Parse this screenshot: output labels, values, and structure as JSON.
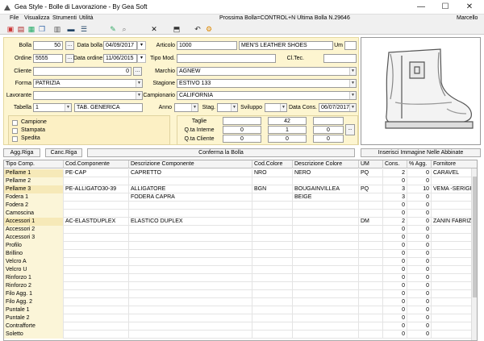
{
  "window": {
    "title": "Gea Style - Bolle di Lavorazione - By Gea Soft",
    "controls": [
      "—",
      "☐",
      "✕"
    ]
  },
  "menu": {
    "items": [
      "File",
      "Visualizza",
      "Strumenti",
      "Utilità"
    ],
    "next_info": "Prossima Bolla=CONTROL+N Ultima Bolla N.29646",
    "user": "Marcello"
  },
  "toolbar": {
    "icons": [
      "print-icon",
      "print-preview-icon",
      "export-icon",
      "copy-icon",
      "grid-icon",
      "save-icon",
      "list-icon",
      "edit-icon",
      "delete-icon",
      "archive-icon",
      "undo-icon",
      "settings-icon"
    ]
  },
  "form": {
    "bolla_label": "Bolla",
    "bolla": "50",
    "data_bolla_label": "Data bolla",
    "data_bolla": "04/09/2017",
    "articolo_label": "Articolo",
    "articolo_code": "1000",
    "articolo_desc": "MEN'S LEATHER SHOES",
    "um_label": "Um",
    "um": "",
    "ordine_label": "Ordine",
    "ordine": "5555",
    "data_ordine_label": "Data ordine",
    "data_ordine": "11/06/2015",
    "tipo_mod_label": "Tipo Mod.",
    "tipo_mod": "",
    "cl_tec_label": "Cl.Tec.",
    "cl_tec": "",
    "cliente_label": "Cliente",
    "cliente": "0",
    "marchio_label": "Marchio",
    "marchio": "AGNEW",
    "forma_label": "Forma",
    "forma": "PATRIZIA",
    "stagione_label": "Stagione",
    "stagione": "ESTIVO 133",
    "lavorante_label": "Lavorante",
    "lavorante": "",
    "campionario_label": "Campionario",
    "campionario": "CALIFORNIA",
    "tabella_label": "Tabella",
    "tabella": "1",
    "tabella_desc": "TAB. GENERICA",
    "anno_label": "Anno",
    "anno": "",
    "stag_label": "Stag.",
    "stag": "",
    "sviluppo_label": "Sviluppo",
    "sviluppo": "",
    "data_cons_label": "Data Cons.",
    "data_cons": "06/07/2017",
    "checks": [
      "Campione",
      "Stampata",
      "Spedita"
    ],
    "taglie_label": "Taglie",
    "qta_interne_label": "Q.ta Interne",
    "qta_cliente_label": "Q.ta Cliente",
    "taglie": [
      "",
      "42",
      ""
    ],
    "qta_interne": [
      "0",
      "1",
      "0"
    ],
    "qta_cliente": [
      "0",
      "0",
      "0"
    ],
    "more_label": "..."
  },
  "actions": {
    "add_row": "Agg.Riga",
    "del_row": "Canc.Riga",
    "confirm": "Conferma la Bolla",
    "insert_image": "Inserisci Immagine Nelle Abbinate"
  },
  "grid": {
    "headers": [
      "Tipo Comp.",
      "Cod.Componente",
      "Descrizione Componente",
      "Cod.Colore",
      "Descrizione Colore",
      "UM",
      "Cons.",
      "% Agg.",
      "Fornitore"
    ],
    "rows": [
      [
        "Pellame 1",
        "PE-CAP",
        "CAPRETTO",
        "NRO",
        "NERO",
        "PQ",
        "2",
        "0",
        "CARAVEL"
      ],
      [
        "Pellame 2",
        "",
        "",
        "",
        "",
        "",
        "0",
        "0",
        ""
      ],
      [
        "Pellame 3",
        "PE-ALLIGATO30-39",
        "ALLIGATORE",
        "BGN",
        "BOUGAINVILLEA",
        "PQ",
        "3",
        "10",
        "VEMA -SERIGRAFIA"
      ],
      [
        "Fodera 1",
        "",
        "FODERA CAPRA",
        "",
        "BEIGE",
        "",
        "3",
        "0",
        ""
      ],
      [
        "Fodera 2",
        "",
        "",
        "",
        "",
        "",
        "0",
        "0",
        ""
      ],
      [
        "Camoscina",
        "",
        "",
        "",
        "",
        "",
        "0",
        "0",
        ""
      ],
      [
        "Accessori 1",
        "AC-ELASTDUPLEX",
        "ELASTICO DUPLEX",
        "",
        "",
        "DM",
        "2",
        "0",
        "ZANIN FABRIZIO"
      ],
      [
        "Accessori 2",
        "",
        "",
        "",
        "",
        "",
        "0",
        "0",
        ""
      ],
      [
        "Accessori 3",
        "",
        "",
        "",
        "",
        "",
        "0",
        "0",
        ""
      ],
      [
        "Profilo",
        "",
        "",
        "",
        "",
        "",
        "0",
        "0",
        ""
      ],
      [
        "Brillino",
        "",
        "",
        "",
        "",
        "",
        "0",
        "0",
        ""
      ],
      [
        "Velcro A",
        "",
        "",
        "",
        "",
        "",
        "0",
        "0",
        ""
      ],
      [
        "Velcro U",
        "",
        "",
        "",
        "",
        "",
        "0",
        "0",
        ""
      ],
      [
        "Rinforzo 1",
        "",
        "",
        "",
        "",
        "",
        "0",
        "0",
        ""
      ],
      [
        "Rinforzo 2",
        "",
        "",
        "",
        "",
        "",
        "0",
        "0",
        ""
      ],
      [
        "Filo Agg. 1",
        "",
        "",
        "",
        "",
        "",
        "0",
        "0",
        ""
      ],
      [
        "Filo Agg. 2",
        "",
        "",
        "",
        "",
        "",
        "0",
        "0",
        ""
      ],
      [
        "Puntale 1",
        "",
        "",
        "",
        "",
        "",
        "0",
        "0",
        ""
      ],
      [
        "Puntale 2",
        "",
        "",
        "",
        "",
        "",
        "0",
        "0",
        ""
      ],
      [
        "Contrafforte",
        "",
        "",
        "",
        "",
        "",
        "0",
        "0",
        ""
      ],
      [
        "Soletto",
        "",
        "",
        "",
        "",
        "",
        "0",
        "0",
        ""
      ]
    ],
    "highlighted": [
      0,
      2,
      6
    ]
  }
}
